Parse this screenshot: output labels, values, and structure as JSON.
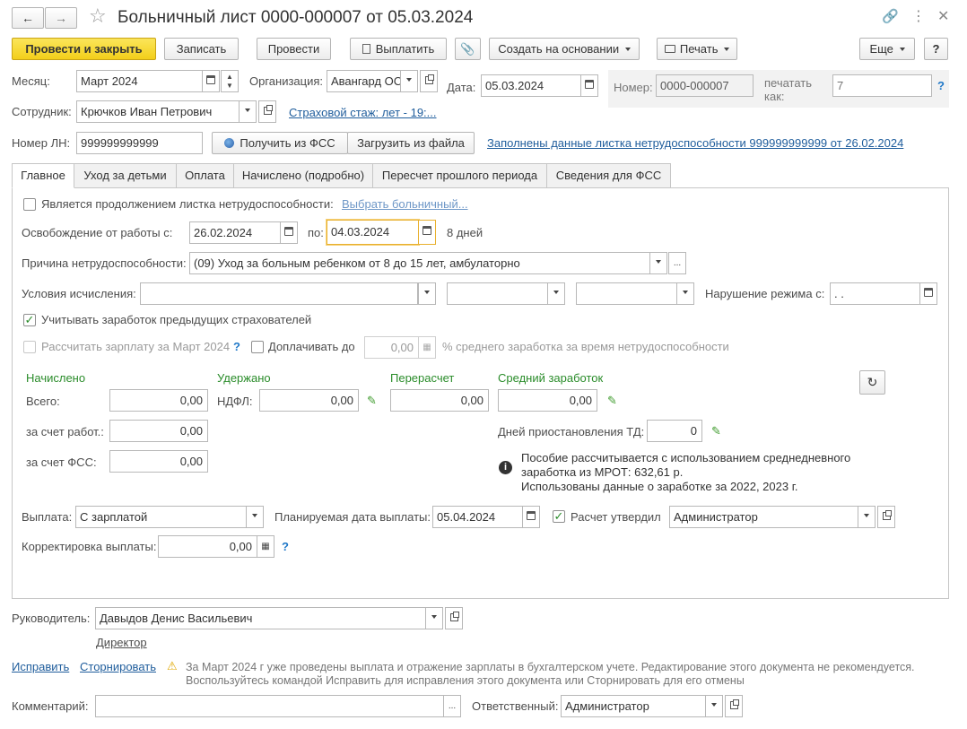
{
  "window": {
    "title": "Больничный лист 0000-000007 от 05.03.2024",
    "back_icon": "arrow-left-icon",
    "forward_icon": "arrow-right-icon"
  },
  "toolbar": {
    "post_close": "Провести и закрыть",
    "save": "Записать",
    "post": "Провести",
    "pay": "Выплатить",
    "create_based": "Создать на основании",
    "print": "Печать",
    "more": "Еще",
    "help": "?"
  },
  "header": {
    "month_label": "Месяц:",
    "month_value": "Март 2024",
    "org_label": "Организация:",
    "org_value": "Авангард ОС",
    "date_label": "Дата:",
    "date_value": "05.03.2024",
    "number_label": "Номер:",
    "number_value": "0000-000007",
    "print_as_label": "печатать как:",
    "print_as_placeholder": "7",
    "employee_label": "Сотрудник:",
    "employee_value": "Крючков Иван Петрович",
    "insurance_link": "Страховой стаж: лет - 19:...",
    "ln_label": "Номер ЛН:",
    "ln_value": "999999999999",
    "get_fss_button": "Получить из ФСС",
    "load_file_button": "Загрузить из файла",
    "filled_link": "Заполнены данные листка нетрудоспособности 999999999999 от 26.02.2024"
  },
  "tabs": [
    {
      "label": "Главное",
      "active": true
    },
    {
      "label": "Уход за детьми",
      "active": false
    },
    {
      "label": "Оплата",
      "active": false
    },
    {
      "label": "Начислено (подробно)",
      "active": false
    },
    {
      "label": "Пересчет прошлого периода",
      "active": false
    },
    {
      "label": "Сведения для ФСС",
      "active": false
    }
  ],
  "main": {
    "continuation_label": "Является продолжением листка нетрудоспособности:",
    "continuation_checked": false,
    "choose_sick_link": "Выбрать больничный...",
    "release_label": "Освобождение от работы с:",
    "release_from": "26.02.2024",
    "release_to_label": "по:",
    "release_to": "04.03.2024",
    "days_text": "8 дней",
    "reason_label": "Причина нетрудоспособности:",
    "reason_value": "(09) Уход за больным ребенком от 8 до 15 лет, амбулаторно",
    "calc_conditions_label": "Условия исчисления:",
    "calc_condition_1": "",
    "calc_condition_2": "",
    "calc_condition_3": "",
    "violation_label": "Нарушение режима с:",
    "violation_value": " .  .",
    "prev_insurers_label": "Учитывать заработок предыдущих страхователей",
    "prev_insurers_checked": true,
    "calc_salary_label": "Рассчитать зарплату за Март 2024",
    "calc_salary_checked": false,
    "pay_extra_label": "Доплачивать до",
    "pay_extra_checked": false,
    "pay_extra_value": "0,00",
    "pay_extra_suffix": "% среднего заработка за время нетрудоспособности",
    "accrued_header": "Начислено",
    "withheld_header": "Удержано",
    "recalc_header": "Перерасчет",
    "avg_header": "Средний заработок",
    "total_label": "Всего:",
    "total_value": "0,00",
    "ndfl_label": "НДФЛ:",
    "ndfl_value": "0,00",
    "recalc_value": "0,00",
    "avg_value": "0,00",
    "employer_label": "за счет работ.:",
    "employer_value": "0,00",
    "fss_label": "за счет ФСС:",
    "fss_value": "0,00",
    "suspension_label": "Дней приостановления ТД:",
    "suspension_value": "0",
    "info_line1": "Пособие рассчитывается с использованием среднедневного",
    "info_line2": "заработка из МРОТ: 632,61 р.",
    "info_line3": "Использованы данные о заработке за  2022,  2023 г.",
    "payout_label": "Выплата:",
    "payout_value": "С зарплатой",
    "planned_date_label": "Планируемая дата выплаты:",
    "planned_date_value": "05.04.2024",
    "approved_label": "Расчет утвердил",
    "approved_checked": true,
    "approved_value": "Администратор",
    "correction_label": "Корректировка выплаты:",
    "correction_value": "0,00"
  },
  "footer": {
    "head_label": "Руководитель:",
    "head_value": "Давыдов Денис Васильевич",
    "head_position": "Директор",
    "fix_link": "Исправить",
    "storno_link": "Сторнировать",
    "warning_line1": "За Март 2024 г уже проведены выплата и отражение зарплаты в бухгалтерском учете. Редактирование этого документа не рекомендуется.",
    "warning_line2": "Воспользуйтесь командой Исправить для исправления этого документа или Сторнировать для его отмены",
    "comment_label": "Комментарий:",
    "comment_value": "",
    "responsible_label": "Ответственный:",
    "responsible_value": "Администратор"
  },
  "colors": {
    "primary_button": "#f3cf1a",
    "link": "#1f5d9c",
    "section_header": "#2a8c2a",
    "focus_border": "#e8b02e"
  }
}
